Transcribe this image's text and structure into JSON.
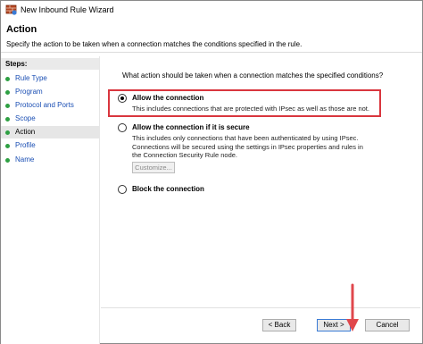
{
  "window": {
    "title": "New Inbound Rule Wizard"
  },
  "header": {
    "heading": "Action",
    "description": "Specify the action to be taken when a connection matches the conditions specified in the rule."
  },
  "steps": {
    "title": "Steps:",
    "items": [
      {
        "label": "Rule Type",
        "active": false
      },
      {
        "label": "Program",
        "active": false
      },
      {
        "label": "Protocol and Ports",
        "active": false
      },
      {
        "label": "Scope",
        "active": false
      },
      {
        "label": "Action",
        "active": true
      },
      {
        "label": "Profile",
        "active": false
      },
      {
        "label": "Name",
        "active": false
      }
    ]
  },
  "main": {
    "question": "What action should be taken when a connection matches the specified conditions?",
    "options": [
      {
        "label": "Allow the connection",
        "description": "This includes connections that are protected with IPsec as well as those are not.",
        "selected": true
      },
      {
        "label": "Allow the connection if it is secure",
        "description": "This includes only connections that have been authenticated by using IPsec.  Connections will be secured using the settings in IPsec properties and rules in the Connection Security Rule node.",
        "selected": false
      },
      {
        "label": "Block the connection",
        "description": "",
        "selected": false
      }
    ],
    "customize_label": "Customize..."
  },
  "footer": {
    "back_label": "< Back",
    "next_label": "Next >",
    "cancel_label": "Cancel"
  },
  "colors": {
    "highlight": "#d9363e",
    "step_link": "#1b4fb4",
    "step_dot": "#2ea043",
    "arrow": "#e0474c"
  },
  "icons": {
    "app": "firewall-wizard-icon",
    "step_bullet": "green-dot-icon",
    "annotation": "red-arrow-icon"
  }
}
